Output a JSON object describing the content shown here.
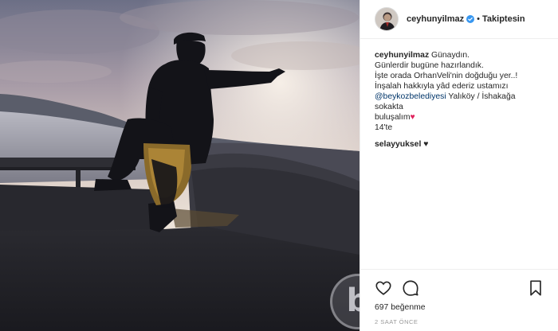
{
  "header": {
    "username": "ceyhunyilmaz",
    "separator": "•",
    "follow_label": "Takiptesin"
  },
  "caption": {
    "username": "ceyhunyilmaz",
    "line1": "Günaydın.",
    "line2": "Günlerdir bugüne hazırlandık.",
    "line3": "İşte orada OrhanVeli'nin doğduğu yer..!",
    "line4": "İnşalah hakkıyla yâd ederiz ustamızı",
    "mention": "@beykozbelediyesi",
    "line5_rest": " Yalıköy / İshakağa sokakta",
    "line6": "buluşalım",
    "heart": "♥",
    "line7": "14'te"
  },
  "comment": {
    "username": "selayyuksel",
    "text": "♥"
  },
  "footer": {
    "likes": "697 beğenme",
    "timestamp": "2 SAAT ÖNCE"
  },
  "watermark": {
    "letter": "b"
  },
  "colors": {
    "verified": "#3897f0",
    "mention": "#003569",
    "heart": "#e0245e",
    "text": "#262626",
    "muted": "#999999"
  },
  "icons": [
    "verified-badge-icon",
    "heart-icon",
    "comment-icon",
    "bookmark-icon"
  ]
}
